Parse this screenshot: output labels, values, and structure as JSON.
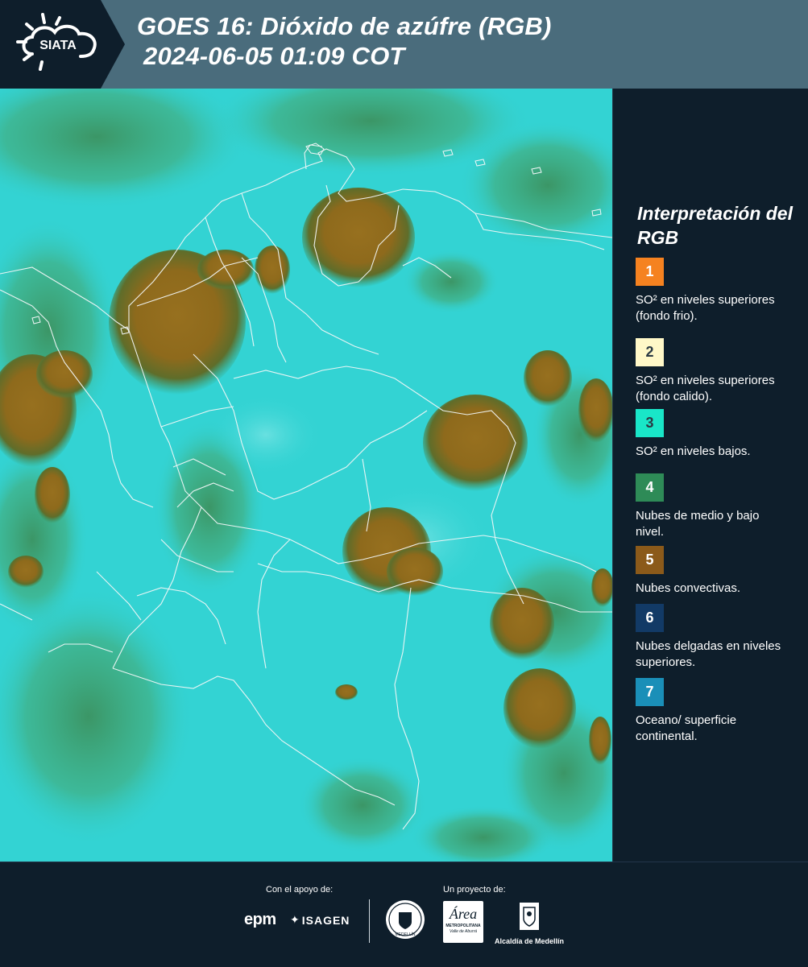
{
  "header": {
    "logo_text": "SIATA",
    "title_line1": "GOES 16: Dióxido de azúfre (RGB)",
    "title_line2": "2024-06-05 01:09 COT"
  },
  "legend": {
    "title": "Interpretación del RGB",
    "items": [
      {
        "number": "1",
        "color": "#f58220",
        "text": "SO² en niveles superiores (fondo frio)."
      },
      {
        "number": "2",
        "color": "#fff8c8",
        "text": "SO² en niveles superiores (fondo calido)."
      },
      {
        "number": "3",
        "color": "#19e6c8",
        "text": "SO² en niveles bajos."
      },
      {
        "number": "4",
        "color": "#2e8b57",
        "text": "Nubes de medio y bajo nivel."
      },
      {
        "number": "5",
        "color": "#8b5a1a",
        "text": "Nubes convectivas."
      },
      {
        "number": "6",
        "color": "#123a66",
        "text": "Nubes delgadas en niveles superiores."
      },
      {
        "number": "7",
        "color": "#1a8fb8",
        "text": "Oceano/ superficie continental."
      }
    ]
  },
  "footer": {
    "support_label": "Con el apoyo de:",
    "project_label": "Un proyecto de:",
    "sponsor_epm": "epm",
    "sponsor_isagen": "ISAGEN",
    "partner_area_name": "Área",
    "partner_area_sub1": "METROPOLITANA",
    "partner_area_sub2": "Valle de Aburrá",
    "partner_alcaldia": "Alcaldía de Medellín",
    "seal_text": "MEDELLÍN"
  },
  "colors": {
    "header_bg": "#4a6c7c",
    "page_bg": "#0e1e2b",
    "map_base": "#33d3d3",
    "cloud_green": "#2f8c55",
    "convective": "#8e6a1c"
  }
}
